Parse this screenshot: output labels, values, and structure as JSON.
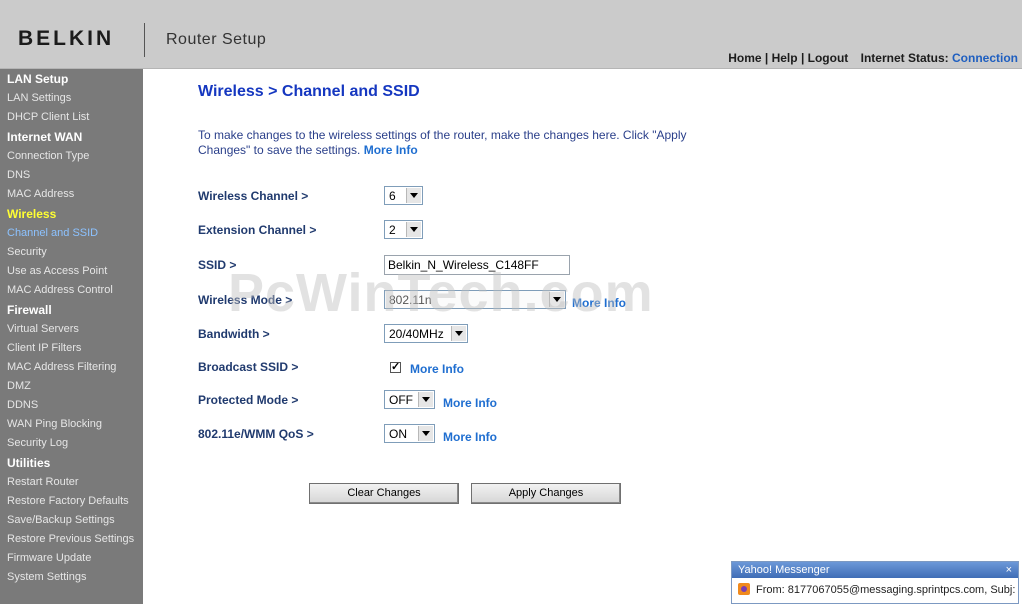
{
  "header": {
    "logo": "BELKIN",
    "product": "Router Setup",
    "nav": {
      "home": "Home",
      "help": "Help",
      "logout": "Logout",
      "sep": " | ",
      "status_label": "Internet Status:",
      "status_value": "Connection"
    }
  },
  "sidebar": {
    "sections": [
      {
        "title": "LAN Setup",
        "items": [
          "LAN Settings",
          "DHCP Client List"
        ]
      },
      {
        "title": "Internet WAN",
        "items": [
          "Connection Type",
          "DNS",
          "MAC Address"
        ]
      },
      {
        "title": "Wireless",
        "items": [
          "Channel and SSID",
          "Security",
          "Use as Access Point",
          "MAC Address Control"
        ]
      },
      {
        "title": "Firewall",
        "items": [
          "Virtual Servers",
          "Client IP Filters",
          "MAC Address Filtering",
          "DMZ",
          "DDNS",
          "WAN Ping Blocking",
          "Security Log"
        ]
      },
      {
        "title": "Utilities",
        "items": [
          "Restart Router",
          "Restore Factory Defaults",
          "Save/Backup Settings",
          "Restore Previous Settings",
          "Firmware Update",
          "System Settings"
        ]
      }
    ]
  },
  "main": {
    "title": "Wireless > Channel and SSID",
    "intro": "To make changes to the wireless settings of the router, make the changes here. Click \"Apply Changes\" to save the settings.",
    "more_info": "More Info",
    "fields": {
      "channel_label": "Wireless Channel >",
      "channel_value": "6",
      "extension_label": "Extension Channel >",
      "extension_value": "2",
      "ssid_label": "SSID >",
      "ssid_value": "Belkin_N_Wireless_C148FF",
      "mode_label": "Wireless Mode >",
      "mode_value": "802.11n",
      "bandwidth_label": "Bandwidth >",
      "bandwidth_value": "20/40MHz",
      "broadcast_label": "Broadcast SSID >",
      "broadcast_checked": true,
      "protected_label": "Protected Mode >",
      "protected_value": "OFF",
      "qos_label": "802.11e/WMM QoS >",
      "qos_value": "ON"
    },
    "buttons": {
      "clear": "Clear Changes",
      "apply": "Apply Changes"
    }
  },
  "watermark": "PcWinTech.com",
  "notification": {
    "title": "Yahoo! Messenger",
    "close": "×",
    "message": "From: 8177067055@messaging.sprintpcs.com, Subj:"
  },
  "colors": {
    "header_bg": "#cbcbcb",
    "sidebar_bg": "#7a7a7a",
    "active_section": "#ffff33",
    "current_item": "#8cc2ff",
    "title_blue": "#1537c0",
    "link_blue": "#1f6ed0"
  }
}
